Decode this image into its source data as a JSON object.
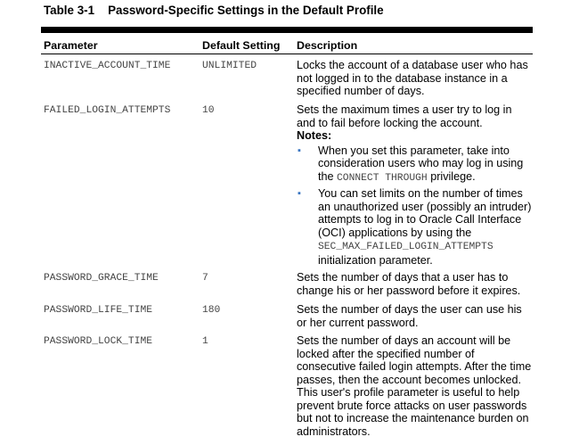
{
  "title": {
    "number": "Table 3-1",
    "text": "Password-Specific Settings in the Default Profile"
  },
  "headers": {
    "parameter": "Parameter",
    "default_setting": "Default Setting",
    "description": "Description"
  },
  "rows": [
    {
      "parameter": "INACTIVE_ACCOUNT_TIME",
      "default": "UNLIMITED",
      "description": "Locks the account of a database user who has not logged in to the database instance in a specified number of days."
    },
    {
      "parameter": "FAILED_LOGIN_ATTEMPTS",
      "default": "10",
      "description": "Sets the maximum times a user try to log in and to fail before locking the account.",
      "notes_label": "Notes:",
      "notes": [
        {
          "before": "When you set this parameter, take into consideration users who may log in using the ",
          "code": "CONNECT THROUGH",
          "after": " privilege."
        },
        {
          "before": "You can set limits on the number of times an unauthorized user (possibly an intruder) attempts to log in to Oracle Call Interface (OCI) applications by using the ",
          "code": "SEC_MAX_FAILED_LOGIN_ATTEMPTS",
          "after": " initialization parameter."
        }
      ]
    },
    {
      "parameter": "PASSWORD_GRACE_TIME",
      "default": "7",
      "description": "Sets the number of days that a user has to change his or her password before it expires."
    },
    {
      "parameter": "PASSWORD_LIFE_TIME",
      "default": "180",
      "description": "Sets the number of days the user can use his or her current password."
    },
    {
      "parameter": "PASSWORD_LOCK_TIME",
      "default": "1",
      "description": "Sets the number of days an account will be locked after the specified number of consecutive failed login attempts. After the time passes, then the account becomes unlocked. This user's profile parameter is useful to help prevent brute force attacks on user passwords but not to increase the maintenance burden on administrators."
    }
  ],
  "colors": {
    "bullet": "#3a76c2",
    "code_text": "#444444"
  }
}
